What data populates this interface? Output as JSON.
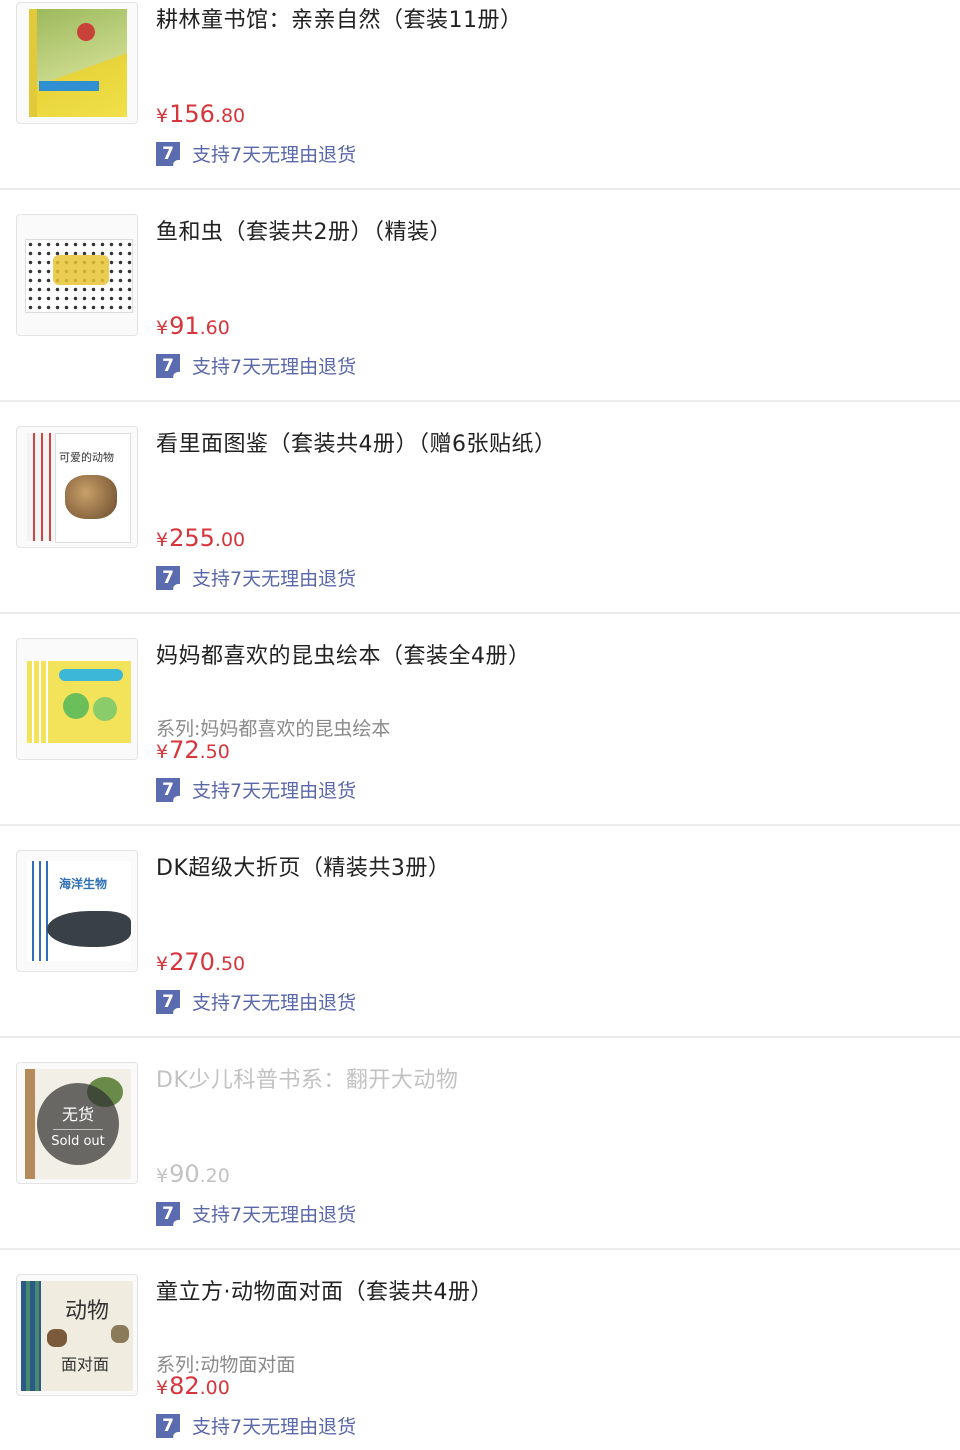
{
  "items": [
    {
      "title": "耕林童书馆：亲亲自然（套装11册）",
      "series": "",
      "price_yen": "¥",
      "price_int": "156",
      "price_dec": ".80",
      "return_label": "支持7天无理由退货",
      "icon": "seven-day-return-icon",
      "thumb_colors": [
        "#e8d43a",
        "#9bb85a",
        "#c9423a"
      ],
      "sold_out": false
    },
    {
      "title": "鱼和虫（套装共2册）（精装）",
      "series": "",
      "price_yen": "¥",
      "price_int": "91",
      "price_dec": ".60",
      "return_label": "支持7天无理由退货",
      "icon": "seven-day-return-icon",
      "thumb_colors": [
        "#ffffff",
        "#3a3a3a",
        "#e9c435"
      ],
      "sold_out": false
    },
    {
      "title": "看里面图鉴（套装共4册）（赠6张贴纸）",
      "series": "",
      "price_yen": "¥",
      "price_int": "255",
      "price_dec": ".00",
      "return_label": "支持7天无理由退货",
      "icon": "seven-day-return-icon",
      "cover_text": "可爱的动物",
      "thumb_colors": [
        "#ffffff",
        "#8a6a4a",
        "#d24b3a"
      ],
      "sold_out": false
    },
    {
      "title": "妈妈都喜欢的昆虫绘本（套装全4册）",
      "series": "系列:妈妈都喜欢的昆虫绘本",
      "price_yen": "¥",
      "price_int": "72",
      "price_dec": ".50",
      "return_label": "支持7天无理由退货",
      "icon": "seven-day-return-icon",
      "thumb_colors": [
        "#f3e35a",
        "#6abf5a",
        "#3db7d8"
      ],
      "sold_out": false
    },
    {
      "title": "DK超级大折页（精装共3册）",
      "series": "",
      "price_yen": "¥",
      "price_int": "270",
      "price_dec": ".50",
      "return_label": "支持7天无理由退货",
      "icon": "seven-day-return-icon",
      "cover_text": "海洋生物",
      "thumb_colors": [
        "#2f6fb6",
        "#3a4048",
        "#ffffff"
      ],
      "sold_out": false
    },
    {
      "title": "DK少儿科普书系：翻开大动物",
      "series": "",
      "price_yen": "¥",
      "price_int": "90",
      "price_dec": ".20",
      "return_label": "支持7天无理由退货",
      "icon": "seven-day-return-icon",
      "sold_out": true,
      "sold_out_cn": "无货",
      "sold_out_en": "Sold out",
      "thumb_colors": [
        "#f2efe6",
        "#b48a5a",
        "#6a8a4a"
      ]
    },
    {
      "title": "童立方·动物面对面（套装共4册）",
      "series": "系列:动物面对面",
      "price_yen": "¥",
      "price_int": "82",
      "price_dec": ".00",
      "return_label": "支持7天无理由退货",
      "icon": "seven-day-return-icon",
      "cover_text_1": "动物",
      "cover_text_2": "面对面",
      "thumb_colors": [
        "#f1ece0",
        "#2a5a8a",
        "#7a5a3a"
      ],
      "sold_out": false
    }
  ],
  "colors": {
    "price": "#d6353b",
    "return_text": "#5a67a8",
    "return_icon": "#5a6bb0",
    "muted": "#8a8a8a",
    "disabled": "#c2c2c2"
  }
}
